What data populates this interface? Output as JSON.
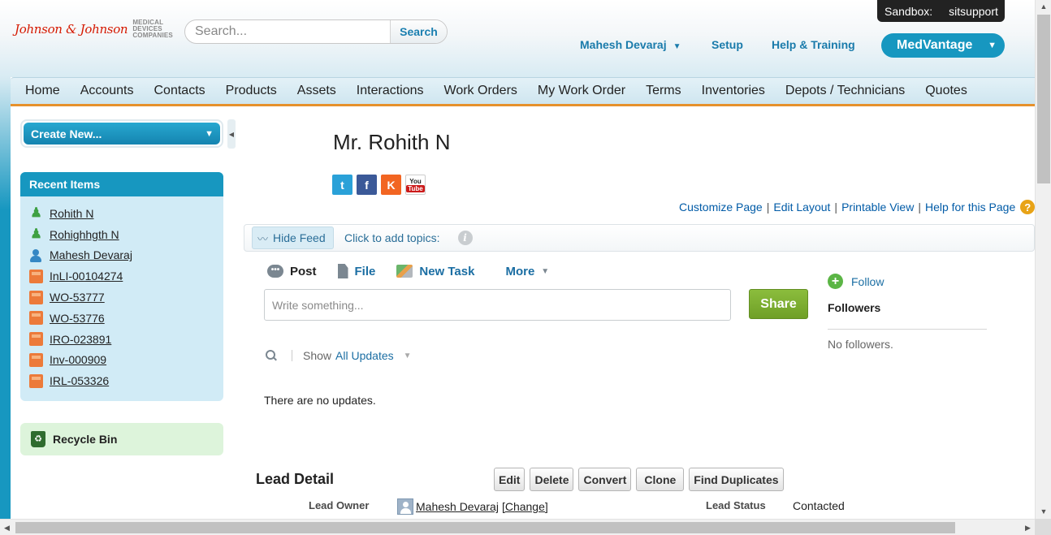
{
  "header": {
    "logo_text": "Johnson & Johnson",
    "logo_sub": [
      "MEDICAL",
      "DEVICES",
      "COMPANIES"
    ],
    "search_placeholder": "Search...",
    "search_button": "Search",
    "sandbox_label": "Sandbox:",
    "sandbox_name": "sitsupport",
    "user_name": "Mahesh Devaraj",
    "setup": "Setup",
    "help_training": "Help & Training",
    "app_name": "MedVantage"
  },
  "tabs": [
    "Home",
    "Accounts",
    "Contacts",
    "Products",
    "Assets",
    "Interactions",
    "Work Orders",
    "My Work Order",
    "Terms",
    "Inventories",
    "Depots / Technicians",
    "Quotes"
  ],
  "sidebar": {
    "create_new": "Create New...",
    "recent_title": "Recent Items",
    "recent_items": [
      {
        "label": "Rohith N",
        "icon": "lead-icon"
      },
      {
        "label": "Rohighhgth N",
        "icon": "lead-icon"
      },
      {
        "label": "Mahesh Devaraj",
        "icon": "contact-icon"
      },
      {
        "label": "InLI-00104274",
        "icon": "box-icon"
      },
      {
        "label": "WO-53777",
        "icon": "box-icon"
      },
      {
        "label": "WO-53776",
        "icon": "box-icon"
      },
      {
        "label": "IRO-023891",
        "icon": "box-icon"
      },
      {
        "label": "Inv-000909",
        "icon": "box-icon"
      },
      {
        "label": "IRL-053326",
        "icon": "box-icon"
      }
    ],
    "recycle_bin": "Recycle Bin"
  },
  "record": {
    "title": "Mr. Rohith N",
    "page_links": [
      "Customize Page",
      "Edit Layout",
      "Printable View",
      "Help for this Page"
    ]
  },
  "feed": {
    "hide_feed": "Hide Feed",
    "add_topics": "Click to add topics:",
    "publisher_tabs": {
      "post": "Post",
      "file": "File",
      "new_task": "New Task",
      "more": "More"
    },
    "post_placeholder": "Write something...",
    "share_button": "Share",
    "show_label": "Show",
    "show_value": "All Updates",
    "empty_message": "There are no updates."
  },
  "followers": {
    "follow": "Follow",
    "title": "Followers",
    "empty": "No followers."
  },
  "lead_detail": {
    "title": "Lead Detail",
    "buttons": [
      "Edit",
      "Delete",
      "Convert",
      "Clone",
      "Find Duplicates"
    ],
    "owner_label": "Lead Owner",
    "owner_value": "Mahesh Devaraj",
    "owner_change": "[Change]",
    "status_label": "Lead Status",
    "status_value": "Contacted"
  },
  "colors": {
    "accent": "#1797c0",
    "tab_underline": "#e6912c",
    "share_green": "#7aad2f",
    "link": "#015ba7"
  }
}
